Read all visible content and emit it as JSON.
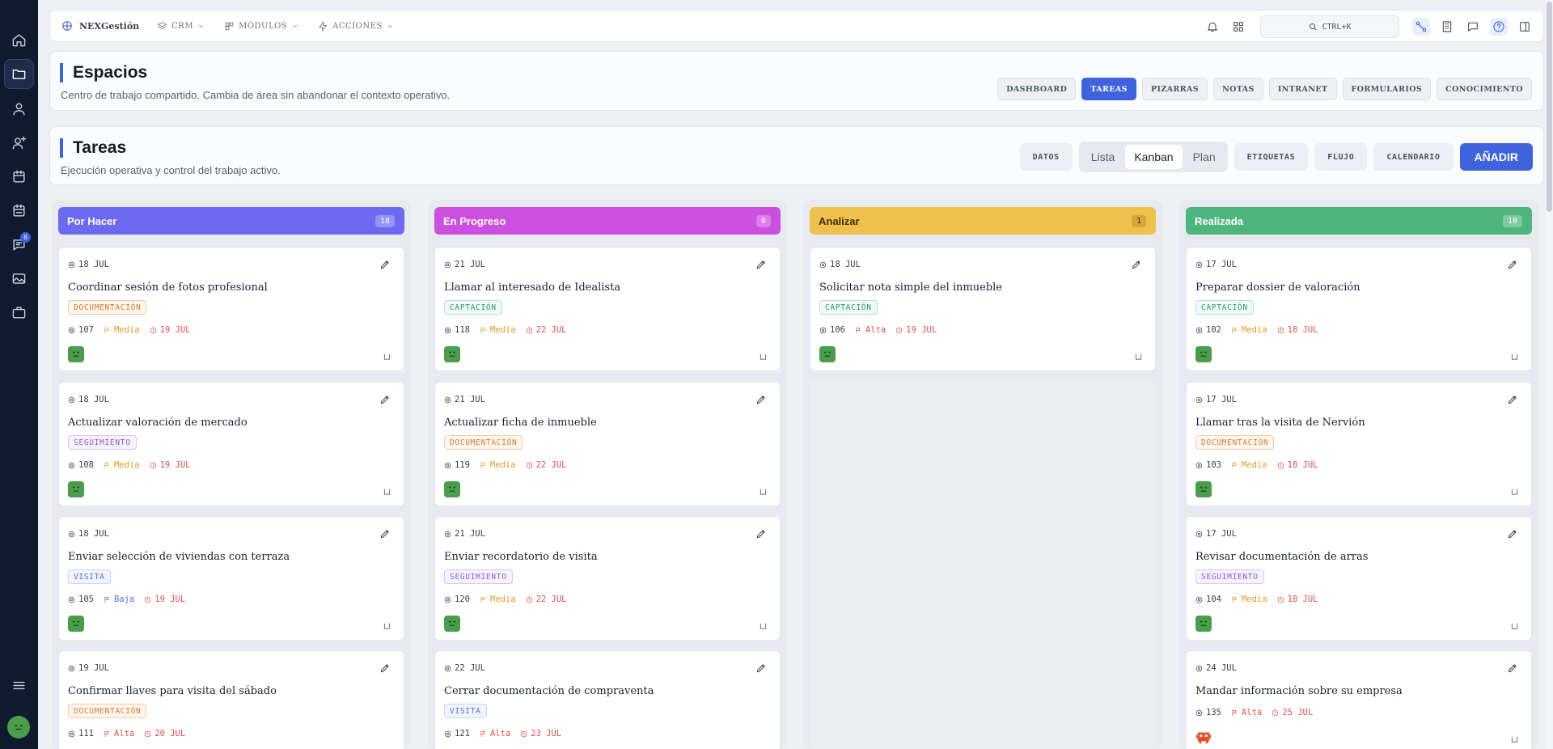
{
  "app": {
    "brand": "NEXGestión",
    "menus": [
      "CRM",
      "MÓDULOS",
      "ACCIONES"
    ],
    "search_label": "CTRL+K",
    "message_badge": "8"
  },
  "rail": {
    "icons": [
      "home-icon",
      "folder-icon",
      "user-icon",
      "user-add-icon",
      "calendar-icon",
      "calendar-check-icon",
      "chat-icon",
      "image-icon",
      "briefcase-icon"
    ],
    "menu_icon": "menu-icon"
  },
  "spaces": {
    "title": "Espacios",
    "subtitle": "Centro de trabajo compartido. Cambia de área sin abandonar el contexto operativo.",
    "tabs": [
      "DASHBOARD",
      "TAREAS",
      "PIZARRAS",
      "NOTAS",
      "INTRANET",
      "FORMULARIOS",
      "CONOCIMIENTO"
    ],
    "active_tab": "TAREAS"
  },
  "tasks": {
    "title": "Tareas",
    "subtitle": "Ejecución operativa y control del trabajo activo.",
    "datos": "DATOS",
    "views": [
      "Lista",
      "Kanban",
      "Plan"
    ],
    "active_view": "Kanban",
    "etiquetas": "ETIQUETAS",
    "flujo": "FLUJO",
    "calendario": "CALENDARIO",
    "add": "AÑADIR"
  },
  "colors": {
    "accent": "#3e63dd",
    "por_hacer": "#6d6af0",
    "en_progreso": "#cc4fe0",
    "analizar": "#f0c04c",
    "realizada": "#4fb57e"
  },
  "columns": [
    {
      "title": "Por Hacer",
      "count": "18",
      "color": "#6d6af0",
      "cards": [
        {
          "date": "18 JUL",
          "title": "Coordinar sesión de fotos profesional",
          "tag": "DOCUMENTACIÓN",
          "num": "107",
          "priority": "Media",
          "due": "19 JUL"
        },
        {
          "date": "18 JUL",
          "title": "Actualizar valoración de mercado",
          "tag": "SEGUIMIENTO",
          "num": "108",
          "priority": "Media",
          "due": "19 JUL"
        },
        {
          "date": "18 JUL",
          "title": "Enviar selección de viviendas con terraza",
          "tag": "VISITA",
          "num": "105",
          "priority": "Baja",
          "due": "19 JUL"
        },
        {
          "date": "19 JUL",
          "title": "Confirmar llaves para visita del sábado",
          "tag": "DOCUMENTACIÓN",
          "num": "111",
          "priority": "Alta",
          "due": "20 JUL"
        }
      ]
    },
    {
      "title": "En Progreso",
      "count": "6",
      "color": "#cc4fe0",
      "cards": [
        {
          "date": "21 JUL",
          "title": "Llamar al interesado de Idealista",
          "tag": "CAPTACIÓN",
          "num": "118",
          "priority": "Media",
          "due": "22 JUL"
        },
        {
          "date": "21 JUL",
          "title": "Actualizar ficha de inmueble",
          "tag": "DOCUMENTACIÓN",
          "num": "119",
          "priority": "Media",
          "due": "22 JUL"
        },
        {
          "date": "21 JUL",
          "title": "Enviar recordatorio de visita",
          "tag": "SEGUIMIENTO",
          "num": "120",
          "priority": "Media",
          "due": "22 JUL"
        },
        {
          "date": "22 JUL",
          "title": "Cerrar documentación de compraventa",
          "tag": "VISITA",
          "num": "121",
          "priority": "Alta",
          "due": "23 JUL"
        }
      ]
    },
    {
      "title": "Analizar",
      "count": "1",
      "color": "#f0c04c",
      "cards": [
        {
          "date": "18 JUL",
          "title": "Solicitar nota simple del inmueble",
          "tag": "CAPTACIÓN",
          "num": "106",
          "priority": "Alta",
          "due": "19 JUL"
        }
      ]
    },
    {
      "title": "Realizada",
      "count": "10",
      "color": "#4fb57e",
      "cards": [
        {
          "date": "17 JUL",
          "title": "Preparar dossier de valoración",
          "tag": "CAPTACIÓN",
          "num": "102",
          "priority": "Media",
          "due": "18 JUL"
        },
        {
          "date": "17 JUL",
          "title": "Llamar tras la visita de Nervión",
          "tag": "DOCUMENTACIÓN",
          "num": "103",
          "priority": "Media",
          "due": "18 JUL"
        },
        {
          "date": "17 JUL",
          "title": "Revisar documentación de arras",
          "tag": "SEGUIMIENTO",
          "num": "104",
          "priority": "Media",
          "due": "18 JUL"
        },
        {
          "date": "24 JUL",
          "title": "Mandar información sobre su empresa",
          "tag": "",
          "num": "135",
          "priority": "Alta",
          "due": "25 JUL",
          "avatar": "orange"
        }
      ]
    }
  ]
}
